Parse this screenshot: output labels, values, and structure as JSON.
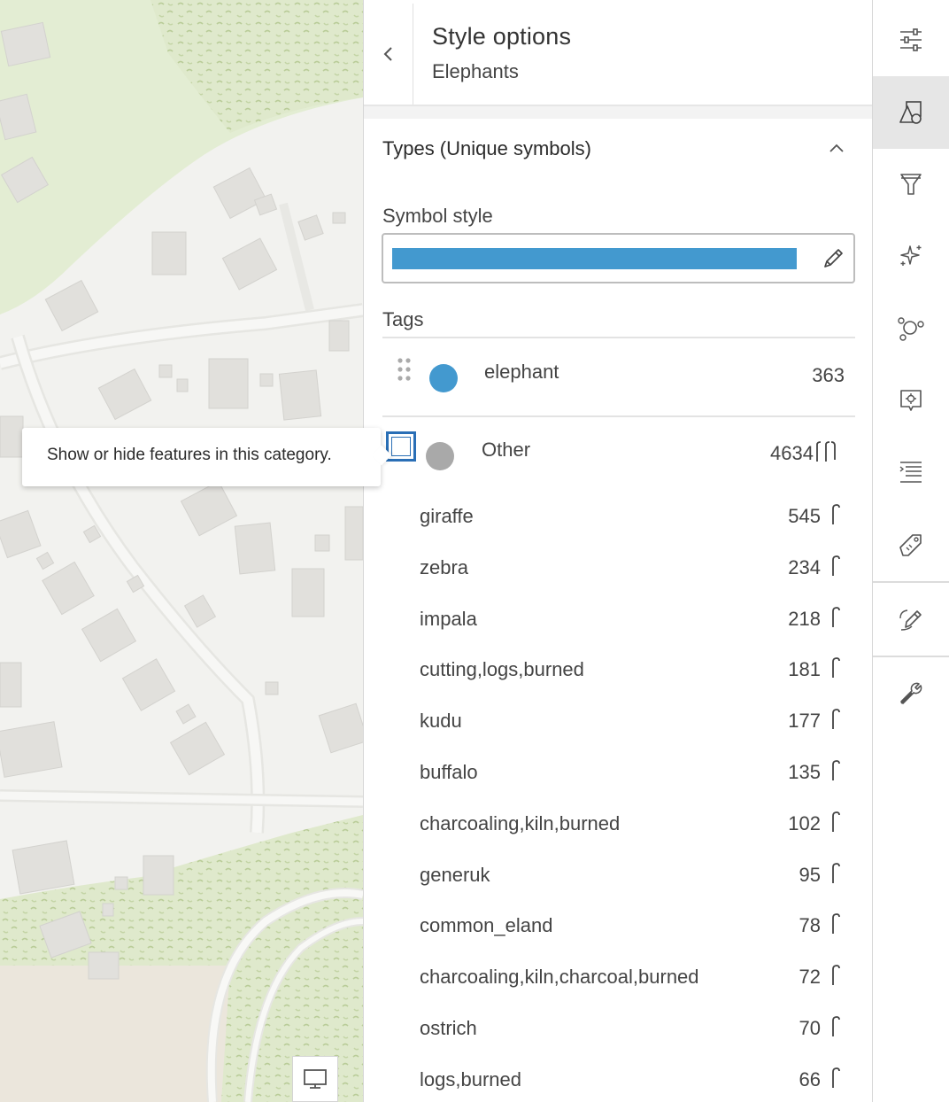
{
  "panel": {
    "title": "Style options",
    "subtitle": "Elephants",
    "section_title": "Types (Unique symbols)",
    "symbol_style_label": "Symbol style",
    "tags_label": "Tags"
  },
  "tooltip": {
    "text": "Show or hide features in this category."
  },
  "tags": [
    {
      "name": "elephant",
      "count": "363",
      "color": "#4399cf"
    },
    {
      "name": "Other",
      "count": "4634",
      "color": "#a9a9a9"
    }
  ],
  "other_items": [
    {
      "name": "giraffe",
      "count": "545"
    },
    {
      "name": "zebra",
      "count": "234"
    },
    {
      "name": "impala",
      "count": "218"
    },
    {
      "name": "cutting,logs,burned",
      "count": "181"
    },
    {
      "name": "kudu",
      "count": "177"
    },
    {
      "name": "buffalo",
      "count": "135"
    },
    {
      "name": "charcoaling,kiln,burned",
      "count": "102"
    },
    {
      "name": "generuk",
      "count": "95"
    },
    {
      "name": "common_eland",
      "count": "78"
    },
    {
      "name": "charcoaling,kiln,charcoal,burned",
      "count": "72"
    },
    {
      "name": "ostrich",
      "count": "70"
    },
    {
      "name": "logs,burned",
      "count": "66"
    }
  ],
  "colors": {
    "ramp": "#4399cf",
    "checkbox_focus": "#2a6fb6",
    "active_tool_bg": "#e6e6e6"
  },
  "toolbar": [
    {
      "icon": "sliders-icon"
    },
    {
      "icon": "styles-icon",
      "active": true
    },
    {
      "icon": "filter-icon"
    },
    {
      "icon": "effects-sparkle-icon"
    },
    {
      "icon": "clustering-icon"
    },
    {
      "icon": "popup-config-icon"
    },
    {
      "icon": "fields-list-icon"
    },
    {
      "icon": "labels-tag-icon"
    },
    {
      "icon": "sketch-pencil-icon"
    },
    {
      "icon": "wrench-icon"
    }
  ]
}
